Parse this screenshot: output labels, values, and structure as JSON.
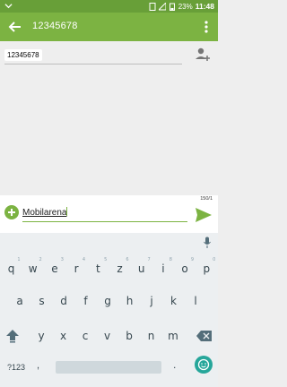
{
  "status_bar": {
    "battery": "23%",
    "time": "11:48"
  },
  "app_bar": {
    "title": "12345678"
  },
  "recipient": {
    "chip_label": "12345678"
  },
  "compose": {
    "counter": "150/1",
    "message_text": "Mobilarena"
  },
  "keyboard": {
    "row1": [
      {
        "k": "q",
        "h": "1"
      },
      {
        "k": "w",
        "h": "2"
      },
      {
        "k": "e",
        "h": "3"
      },
      {
        "k": "r",
        "h": "4"
      },
      {
        "k": "t",
        "h": "5"
      },
      {
        "k": "z",
        "h": "6"
      },
      {
        "k": "u",
        "h": "7"
      },
      {
        "k": "i",
        "h": "8"
      },
      {
        "k": "o",
        "h": "9"
      },
      {
        "k": "p",
        "h": "0"
      }
    ],
    "row2": [
      "a",
      "s",
      "d",
      "f",
      "g",
      "h",
      "j",
      "k",
      "l"
    ],
    "row3": [
      "y",
      "x",
      "c",
      "v",
      "b",
      "n",
      "m"
    ],
    "symbols_label": "?123",
    "comma_label": ",",
    "period_label": "."
  },
  "colors": {
    "primary": "#7cb342",
    "primary_dark": "#689f38",
    "accent": "#26a69a"
  }
}
